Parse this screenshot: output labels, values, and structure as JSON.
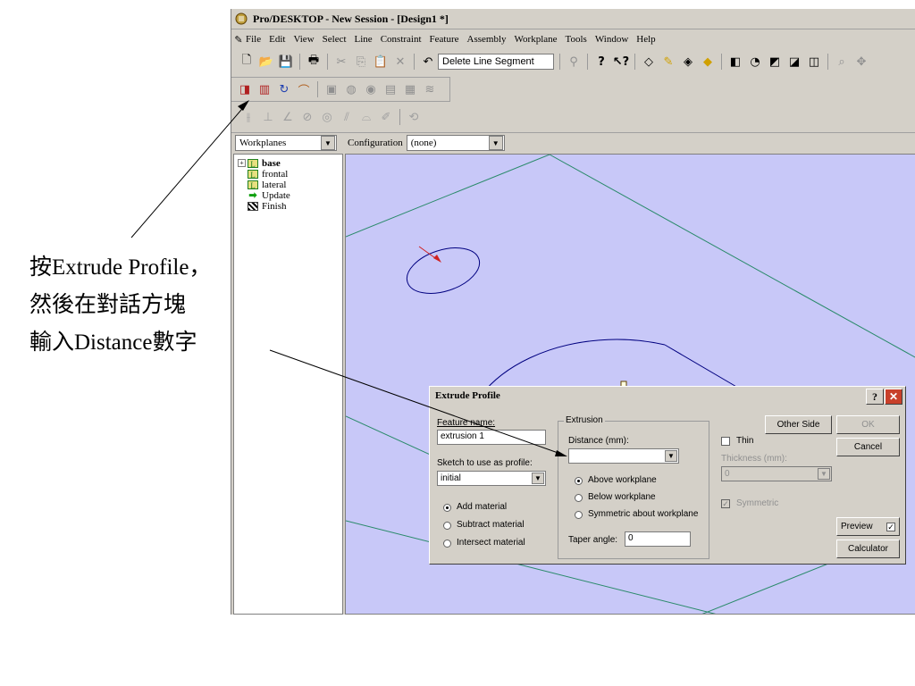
{
  "window": {
    "title": "Pro/DESKTOP - New Session - [Design1 *]"
  },
  "menu": [
    "File",
    "Edit",
    "View",
    "Select",
    "Line",
    "Constraint",
    "Feature",
    "Assembly",
    "Workplane",
    "Tools",
    "Window",
    "Help"
  ],
  "toolbar": {
    "command_field": "Delete Line Segment"
  },
  "panel": {
    "selector_value": "Workplanes",
    "configuration_label": "Configuration",
    "configuration_value": "(none)"
  },
  "tree": {
    "items": [
      "base",
      "frontal",
      "lateral",
      "Update",
      "Finish"
    ]
  },
  "dialog": {
    "title": "Extrude Profile",
    "feature_name_label": "Feature name:",
    "feature_name_value": "extrusion 1",
    "sketch_label": "Sketch to use as profile:",
    "sketch_value": "initial",
    "add_material": "Add material",
    "subtract_material": "Subtract material",
    "intersect_material": "Intersect material",
    "extrusion_group": "Extrusion",
    "distance_label": "Distance (mm):",
    "distance_value": "",
    "above_workplane": "Above workplane",
    "below_workplane": "Below workplane",
    "symmetric_workplane": "Symmetric about workplane",
    "taper_label": "Taper angle:",
    "taper_value": "0",
    "other_side": "Other Side",
    "thin_label": "Thin",
    "thickness_label": "Thickness (mm):",
    "thickness_value": "0",
    "symmetric_label": "Symmetric",
    "ok": "OK",
    "cancel": "Cancel",
    "preview": "Preview",
    "calculator": "Calculator",
    "help_glyph": "?",
    "close_glyph": "✕"
  },
  "annotation": {
    "line1": "按Extrude Profile，",
    "line2": "然後在對話方塊",
    "line3": "輸入Distance數字"
  },
  "colors": {
    "viewport": "#c8c8f8",
    "workplane_lines": "#2a8a6a",
    "profile_lines": "#000080",
    "close_button": "#c8402a"
  }
}
